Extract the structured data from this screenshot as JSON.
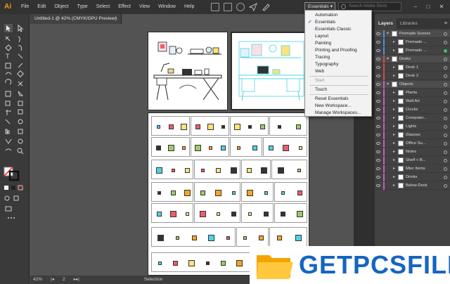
{
  "app": {
    "logo": "Ai"
  },
  "menubar": {
    "items": [
      "File",
      "Edit",
      "Object",
      "Type",
      "Select",
      "Effect",
      "View",
      "Window",
      "Help"
    ],
    "workspace_button": "Essentials",
    "search_placeholder": "Search Adobe Stock"
  },
  "document": {
    "tab_title": "Untitled-1 @ 42% (CMYK/GPU Preview)"
  },
  "statusbar": {
    "zoom": "42%",
    "artboard_number": "2",
    "tool_label": "Selection"
  },
  "workspace_menu": {
    "items": [
      {
        "label": "Automation",
        "checked": false,
        "disabled": false
      },
      {
        "label": "Essentials",
        "checked": true,
        "disabled": false
      },
      {
        "label": "Essentials Classic",
        "checked": false,
        "disabled": false
      },
      {
        "label": "Layout",
        "checked": false,
        "disabled": false
      },
      {
        "label": "Painting",
        "checked": false,
        "disabled": false
      },
      {
        "label": "Printing and Proofing",
        "checked": false,
        "disabled": false
      },
      {
        "label": "Tracing",
        "checked": false,
        "disabled": false
      },
      {
        "label": "Typography",
        "checked": false,
        "disabled": false
      },
      {
        "label": "Web",
        "checked": false,
        "disabled": false
      },
      {
        "label": "Start",
        "checked": false,
        "disabled": true
      },
      {
        "label": "Touch",
        "checked": false,
        "disabled": false
      },
      {
        "label": "Reset Essentials",
        "checked": false,
        "disabled": false
      },
      {
        "label": "New Workspace...",
        "checked": false,
        "disabled": false
      },
      {
        "label": "Manage Workspaces...",
        "checked": false,
        "disabled": false
      }
    ]
  },
  "layers_panel": {
    "tabs": [
      "Layers",
      "Libraries"
    ],
    "layers": [
      {
        "name": "Premade Scenes",
        "level": 0,
        "color": "#4a90e2",
        "top": true
      },
      {
        "name": "Premade ...",
        "level": 1,
        "color": "#4a90e2",
        "top": false
      },
      {
        "name": "Premade ...",
        "level": 1,
        "color": "#4a90e2",
        "top": false,
        "selected": true
      },
      {
        "name": "Desks",
        "level": 0,
        "color": "#d94a4a",
        "top": true
      },
      {
        "name": "Desk 1",
        "level": 1,
        "color": "#d94a4a",
        "top": false
      },
      {
        "name": "Desk 2",
        "level": 1,
        "color": "#d94a4a",
        "top": false
      },
      {
        "name": "Objects",
        "level": 0,
        "color": "#c060c0",
        "top": true
      },
      {
        "name": "Plants",
        "level": 1,
        "color": "#c060c0",
        "top": false
      },
      {
        "name": "Wall Art",
        "level": 1,
        "color": "#c060c0",
        "top": false
      },
      {
        "name": "Clocks",
        "level": 1,
        "color": "#c060c0",
        "top": false
      },
      {
        "name": "Computer...",
        "level": 1,
        "color": "#c060c0",
        "top": false
      },
      {
        "name": "Lights",
        "level": 1,
        "color": "#c060c0",
        "top": false
      },
      {
        "name": "Glasses",
        "level": 1,
        "color": "#c060c0",
        "top": false
      },
      {
        "name": "Office Su...",
        "level": 1,
        "color": "#c060c0",
        "top": false
      },
      {
        "name": "Notes",
        "level": 1,
        "color": "#c060c0",
        "top": false
      },
      {
        "name": "Shelf + B...",
        "level": 1,
        "color": "#c060c0",
        "top": false
      },
      {
        "name": "Misc Items",
        "level": 1,
        "color": "#c060c0",
        "top": false
      },
      {
        "name": "Drinks",
        "level": 1,
        "color": "#c060c0",
        "top": false
      },
      {
        "name": "Below Desk",
        "level": 1,
        "color": "#c060c0",
        "top": false
      }
    ]
  },
  "watermark": {
    "text": "GETPCSFILE"
  },
  "colors": {
    "accent_blue": "#1473e6",
    "selection_cyan": "#4fd3e8",
    "logo_orange": "#ff9a00"
  }
}
